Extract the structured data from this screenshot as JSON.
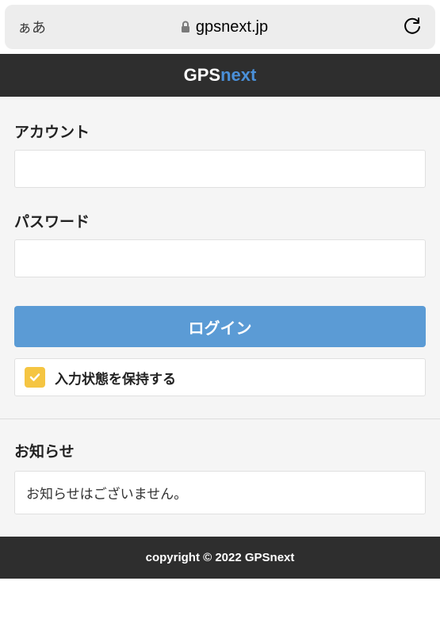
{
  "browser": {
    "aa": "ぁあ",
    "url": "gpsnext.jp"
  },
  "header": {
    "brand_prefix": "GPS",
    "brand_suffix": "next"
  },
  "form": {
    "account_label": "アカウント",
    "account_value": "",
    "password_label": "パスワード",
    "password_value": "",
    "login_button": "ログイン",
    "remember_label": "入力状態を保持する",
    "remember_checked": true
  },
  "notice": {
    "title": "お知らせ",
    "body": "お知らせはございません。"
  },
  "footer": {
    "copyright": "copyright © 2022 GPSnext"
  }
}
